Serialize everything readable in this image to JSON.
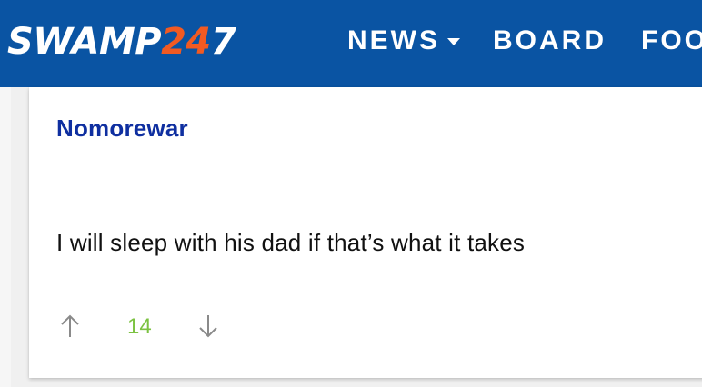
{
  "header": {
    "logo": {
      "text_main": "SWAMP",
      "text_num": "24",
      "text_num_last": "7",
      "accent_color": "#f15a22"
    },
    "nav": [
      {
        "label": "NEWS",
        "has_dropdown": true
      },
      {
        "label": "BOARD",
        "has_dropdown": false
      },
      {
        "label": "FOO",
        "has_dropdown": false
      }
    ],
    "background_color": "#0a54a3"
  },
  "post": {
    "author": "Nomorewar",
    "message": "I will sleep with his dad if that’s what it takes",
    "votes": {
      "count": "14",
      "count_color": "#7cc242",
      "up_icon": "arrow-up-icon",
      "down_icon": "arrow-down-icon"
    }
  }
}
